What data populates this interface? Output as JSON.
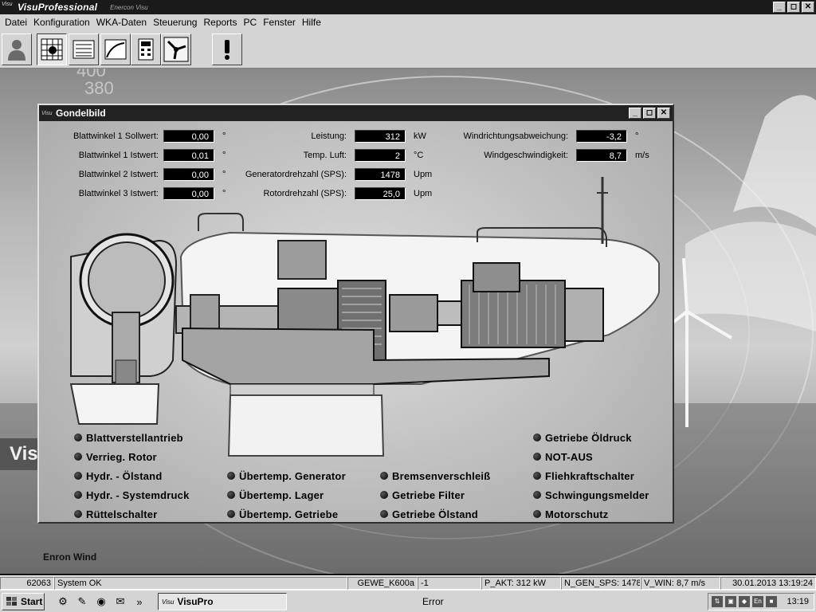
{
  "app": {
    "icon_text": "Visu",
    "title": "VisuProfessional",
    "subtitle": "Enercon Visu"
  },
  "window_controls": {
    "minimize": "_",
    "maximize": "◻",
    "close": "✕"
  },
  "menu": [
    {
      "label": "Datei"
    },
    {
      "label": "Konfiguration"
    },
    {
      "label": "WKA-Daten"
    },
    {
      "label": "Steuerung"
    },
    {
      "label": "Reports"
    },
    {
      "label": "PC"
    },
    {
      "label": "Fenster"
    },
    {
      "label": "Hilfe"
    }
  ],
  "toolbar": {
    "buttons": [
      "user-icon",
      "grid-data-icon",
      "table-icon",
      "curve-chart-icon",
      "calculator-icon",
      "turbine-icon",
      "alert-icon"
    ]
  },
  "desktop": {
    "brand_text": "Visu",
    "enron_label": "Enron Wind"
  },
  "gondel": {
    "title": "Gondelbild",
    "left_fields": [
      {
        "label": "Blattwinkel 1 Sollwert:",
        "value": "0,00",
        "unit": "°"
      },
      {
        "label": "Blattwinkel 1 Istwert:",
        "value": "0,01",
        "unit": "°"
      },
      {
        "label": "Blattwinkel 2 Istwert:",
        "value": "0,00",
        "unit": "°"
      },
      {
        "label": "Blattwinkel 3 Istwert:",
        "value": "0,00",
        "unit": "°"
      }
    ],
    "mid_fields": [
      {
        "label": "Leistung:",
        "value": "312",
        "unit": "kW"
      },
      {
        "label": "Temp. Luft:",
        "value": "2",
        "unit": "°C"
      },
      {
        "label": "Generatordrehzahl (SPS):",
        "value": "1478",
        "unit": "Upm"
      },
      {
        "label": "Rotordrehzahl (SPS):",
        "value": "25,0",
        "unit": "Upm"
      }
    ],
    "right_fields": [
      {
        "label": "Windrichtungsabweichung:",
        "value": "-3,2",
        "unit": "°"
      },
      {
        "label": "Windgeschwindigkeit:",
        "value": "8,7",
        "unit": "m/s"
      }
    ],
    "status": {
      "col1": [
        "Blattverstellantrieb",
        "Verrieg. Rotor",
        "Hydr. - Ölstand",
        "Hydr. - Systemdruck",
        "Rüttelschalter"
      ],
      "col2": [
        "Übertemp. Generator",
        "Übertemp. Lager",
        "Übertemp. Getriebe"
      ],
      "col3": [
        "Bremsenverschleiß",
        "Getriebe Filter",
        "Getriebe Ölstand"
      ],
      "col4": [
        "Getriebe Öldruck",
        "NOT-AUS",
        "Fliehkraftschalter",
        "Schwingungsmelder",
        "Motorschutz"
      ]
    }
  },
  "statusbar": {
    "id": "62063",
    "system": "System  OK",
    "turbine": "GEWE_K600a",
    "code": "-1",
    "p_akt": "P_AKT: 312 kW",
    "n_gen": "N_GEN_SPS: 1478",
    "v_win": "V_WIN: 8,7 m/s",
    "datetime": "30.01.2013  13:19:24"
  },
  "taskbar": {
    "start": "Start",
    "chevron": "»",
    "task_active": "VisuPro",
    "task_inactive": "Error",
    "clock": "13:19",
    "lang": "En"
  },
  "colors": {
    "title_bg": "#1a1a1a",
    "face": "#d4d4d4",
    "display_bg": "#000000",
    "display_fg": "#ffffff"
  }
}
